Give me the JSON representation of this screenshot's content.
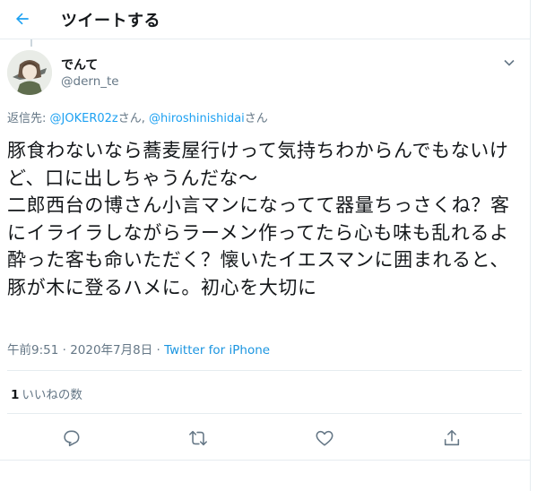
{
  "header": {
    "title": "ツイートする",
    "back_icon": "arrow-left-icon"
  },
  "accent_color": "#1da1f2",
  "author": {
    "display_name": "でんて",
    "handle": "@dern_te"
  },
  "reply_to": {
    "prefix": "返信先: ",
    "mention_1": "@JOKER02z",
    "suffix_1": "さん, ",
    "mention_2": "@hiroshinishidai",
    "suffix_2": "さん"
  },
  "tweet": {
    "text": "豚食わないなら蕎麦屋行けって気持ちわからんでもないけど、口に出しちゃうんだな〜\n二郎西台の博さん小言マンになってて器量ちっさくね？客にイライラしながらラーメン作ってたら心も味も乱れるよ\n酔った客も命いただく？懐いたイエスマンに囲まれると、豚が木に登るハメに。初心を大切に"
  },
  "meta": {
    "time": "午前9:51",
    "separator": " · ",
    "date": "2020年7月8日",
    "source": "Twitter for iPhone"
  },
  "stats": {
    "likes_count": "1",
    "likes_label": "いいねの数"
  },
  "actions": [
    "reply-icon",
    "retweet-icon",
    "like-icon",
    "share-icon"
  ]
}
